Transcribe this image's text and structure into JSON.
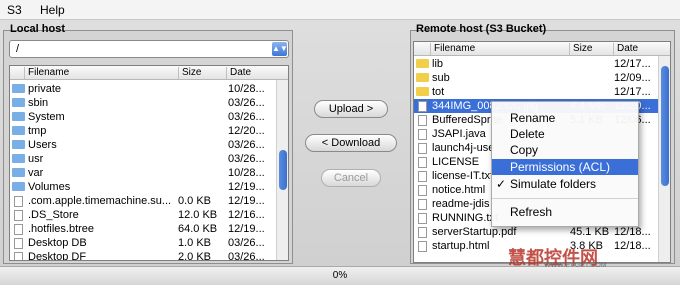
{
  "menubar": {
    "items": [
      "S3",
      "Help"
    ]
  },
  "local": {
    "title": "Local host",
    "path": "/",
    "columns": [
      "Filename",
      "Size",
      "Date"
    ],
    "rows": [
      {
        "type": "folder",
        "name": "private",
        "size": "",
        "date": "10/28..."
      },
      {
        "type": "folder",
        "name": "sbin",
        "size": "",
        "date": "03/26..."
      },
      {
        "type": "folder",
        "name": "System",
        "size": "",
        "date": "03/26..."
      },
      {
        "type": "folder",
        "name": "tmp",
        "size": "",
        "date": "12/20..."
      },
      {
        "type": "folder",
        "name": "Users",
        "size": "",
        "date": "03/26..."
      },
      {
        "type": "folder",
        "name": "usr",
        "size": "",
        "date": "03/26..."
      },
      {
        "type": "folder",
        "name": "var",
        "size": "",
        "date": "10/28..."
      },
      {
        "type": "folder",
        "name": "Volumes",
        "size": "",
        "date": "12/19..."
      },
      {
        "type": "file",
        "name": ".com.apple.timemachine.su...",
        "size": "0.0 KB",
        "date": "12/19..."
      },
      {
        "type": "file",
        "name": ".DS_Store",
        "size": "12.0 KB",
        "date": "12/16..."
      },
      {
        "type": "file",
        "name": ".hotfiles.btree",
        "size": "64.0 KB",
        "date": "12/19..."
      },
      {
        "type": "file",
        "name": "Desktop DB",
        "size": "1.0 KB",
        "date": "03/26..."
      },
      {
        "type": "file",
        "name": "Desktop DF",
        "size": "2.0 KB",
        "date": "03/26..."
      }
    ]
  },
  "buttons": {
    "upload": "Upload >",
    "download": "< Download",
    "cancel": "Cancel"
  },
  "remote": {
    "title": "Remote host (S3 Bucket)",
    "columns": [
      "Filename",
      "Size",
      "Date"
    ],
    "rows": [
      {
        "type": "folder",
        "name": "lib",
        "size": "",
        "date": "12/17..."
      },
      {
        "type": "folder",
        "name": "sub",
        "size": "",
        "date": "12/09..."
      },
      {
        "type": "folder",
        "name": "tot",
        "size": "",
        "date": "12/17..."
      },
      {
        "type": "file",
        "name": "344IMG_0082.CC.jpg",
        "size": "4.4 MB",
        "date": "12/20..."
      },
      {
        "type": "file",
        "name": "BufferedSprite",
        "size": "5.1 KB",
        "date": "12/06..."
      },
      {
        "type": "file",
        "name": "JSAPI.java",
        "size": "",
        "date": ""
      },
      {
        "type": "file",
        "name": "launch4j-use",
        "size": "",
        "date": ""
      },
      {
        "type": "file",
        "name": "LICENSE",
        "size": "",
        "date": ""
      },
      {
        "type": "file",
        "name": "license-IT.txt",
        "size": "",
        "date": ""
      },
      {
        "type": "file",
        "name": "notice.html",
        "size": "",
        "date": ""
      },
      {
        "type": "file",
        "name": "readme-jdis",
        "size": "",
        "date": ""
      },
      {
        "type": "file",
        "name": "RUNNING.txt",
        "size": "",
        "date": ""
      },
      {
        "type": "file",
        "name": "serverStartup.pdf",
        "size": "45.1 KB",
        "date": "12/18..."
      },
      {
        "type": "file",
        "name": "startup.html",
        "size": "3.8 KB",
        "date": "12/18..."
      }
    ]
  },
  "context_menu": {
    "items": [
      {
        "label": "Rename",
        "checked": false
      },
      {
        "label": "Delete",
        "checked": false
      },
      {
        "label": "Copy",
        "checked": false
      },
      {
        "label": "Permissions (ACL)",
        "checked": false,
        "highlighted": true
      },
      {
        "label": "Simulate folders",
        "checked": true
      },
      {
        "label": "Refresh",
        "checked": false
      }
    ],
    "checkmark": "✓"
  },
  "status": {
    "progress": "0%"
  },
  "watermark": {
    "text": "慧都控件网",
    "sub": "WWW.EVGET.COM"
  }
}
